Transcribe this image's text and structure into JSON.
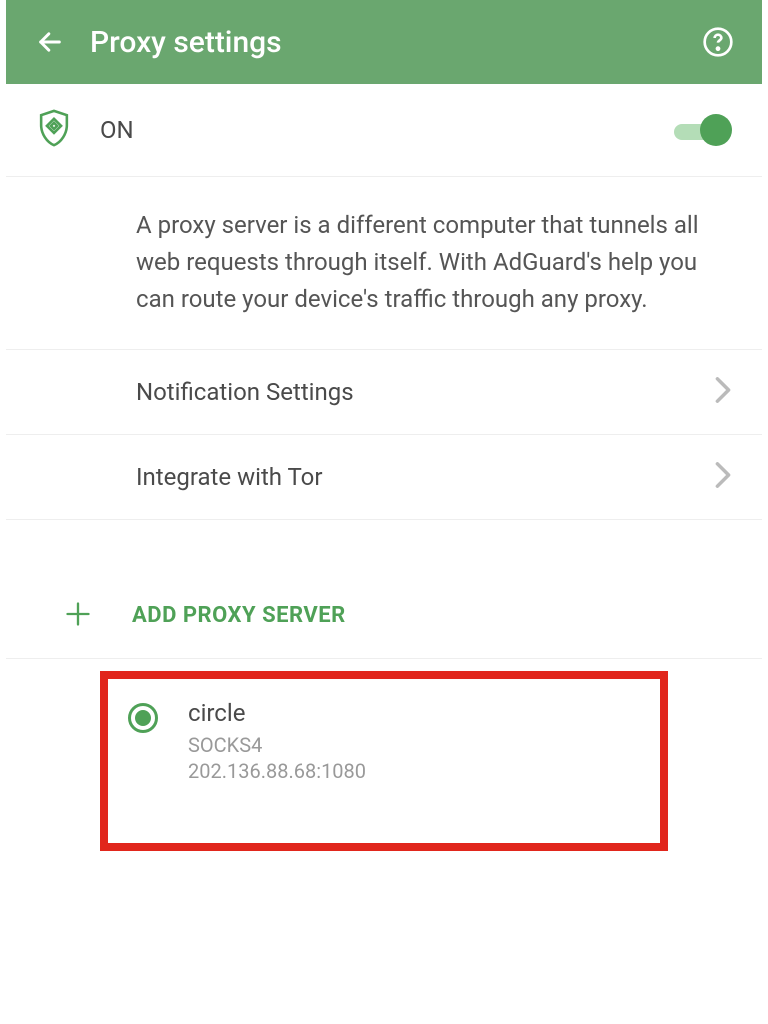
{
  "header": {
    "title": "Proxy settings"
  },
  "status": {
    "label": "ON"
  },
  "description": "A proxy server is a different computer that tunnels all web requests through itself. With AdGuard's help you can route your device's traffic through any proxy.",
  "menu": {
    "notification": "Notification Settings",
    "tor": "Integrate with Tor"
  },
  "add": {
    "label": "ADD PROXY SERVER"
  },
  "proxy": {
    "name": "circle",
    "type": "SOCKS4",
    "address": "202.136.88.68:1080"
  }
}
